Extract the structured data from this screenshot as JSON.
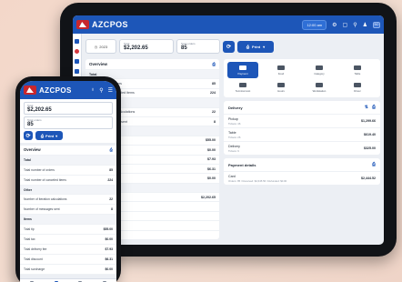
{
  "brand": "AZCPOS",
  "tablet": {
    "time": "12:00 am",
    "avatar": "BO",
    "filter": {
      "date": "2023",
      "total_label": "Total",
      "total_value": "$2,202.65",
      "orders_label": "Total orders",
      "orders_value": "85"
    },
    "refresh_label": "⟳",
    "print_label": "Print",
    "overview": {
      "title": "Overview",
      "rows": [
        {
          "label": "Total",
          "value": "",
          "section": true
        },
        {
          "label": "Total number of orders",
          "value": "85"
        },
        {
          "label": "Total number of canceled items",
          "value": "224"
        },
        {
          "label": "Other",
          "value": "",
          "section": true
        },
        {
          "label": "Number of iteration calculations",
          "value": "22"
        },
        {
          "label": "Number of messages sent",
          "value": "8"
        },
        {
          "label": "Items",
          "value": "",
          "section": true
        },
        {
          "label": "Total tip",
          "value": "$55.00"
        },
        {
          "label": "Total tax",
          "value": "$0.00"
        },
        {
          "label": "Total delivery fee",
          "value": "$7.93"
        },
        {
          "label": "Total discount",
          "value": "$6.31"
        },
        {
          "label": "Total surcharge",
          "value": "$0.00"
        },
        {
          "label": "Payments",
          "value": "",
          "section": true
        },
        {
          "label": "Total net revenue",
          "value": "$2,202.65"
        },
        {
          "label": "",
          "value": ""
        },
        {
          "label": "",
          "value": ""
        },
        {
          "label": "",
          "value": ""
        },
        {
          "label": "",
          "value": ""
        }
      ]
    },
    "tabs": [
      {
        "label": "Payment",
        "active": true
      },
      {
        "label": "Food"
      },
      {
        "label": "Category"
      },
      {
        "label": "Table"
      },
      {
        "label": "Terminal cost"
      },
      {
        "label": "Hours"
      },
      {
        "label": "Workstation"
      },
      {
        "label": "Driver"
      }
    ],
    "delivery": {
      "title": "Delivery",
      "rows": [
        {
          "name": "Pickup",
          "sub": "Tickets: 46",
          "amount": "$1,299.66"
        },
        {
          "name": "Table",
          "sub": "Tickets: 26",
          "amount": "$619.40"
        },
        {
          "name": "Delivery",
          "sub": "Tickets: 9",
          "amount": "$325.00"
        }
      ]
    },
    "payments": {
      "title": "Payment details",
      "rows": [
        {
          "name": "Card",
          "sub": "Orders: 85 / Received: $2,645.56 / Refunded: $0.00",
          "amount": "$2,444.52"
        }
      ]
    }
  },
  "phone": {
    "total_label": "Total",
    "total_value": "$2,202.65",
    "orders_label": "Total orders",
    "orders_value": "85",
    "print_label": "Print",
    "overview": {
      "title": "Overview",
      "rows": [
        {
          "label": "Total",
          "value": "",
          "section": true
        },
        {
          "label": "Total number of orders",
          "value": "85"
        },
        {
          "label": "Total number of canceled items",
          "value": "224"
        },
        {
          "label": "Other",
          "value": "",
          "section": true
        },
        {
          "label": "Number of iteration calculations",
          "value": "22"
        },
        {
          "label": "Number of messages sent",
          "value": "8"
        },
        {
          "label": "Items",
          "value": "",
          "section": true
        },
        {
          "label": "Total tip",
          "value": "$55.00"
        },
        {
          "label": "Total tax",
          "value": "$0.00"
        },
        {
          "label": "Total delivery fee",
          "value": "$7.93"
        },
        {
          "label": "Total discount",
          "value": "$6.31"
        },
        {
          "label": "Total surcharge",
          "value": "$0.00"
        }
      ]
    }
  },
  "colors": {
    "primary": "#1d56b8",
    "logo_red": "#c9262c",
    "background": "#f3d7c9"
  }
}
